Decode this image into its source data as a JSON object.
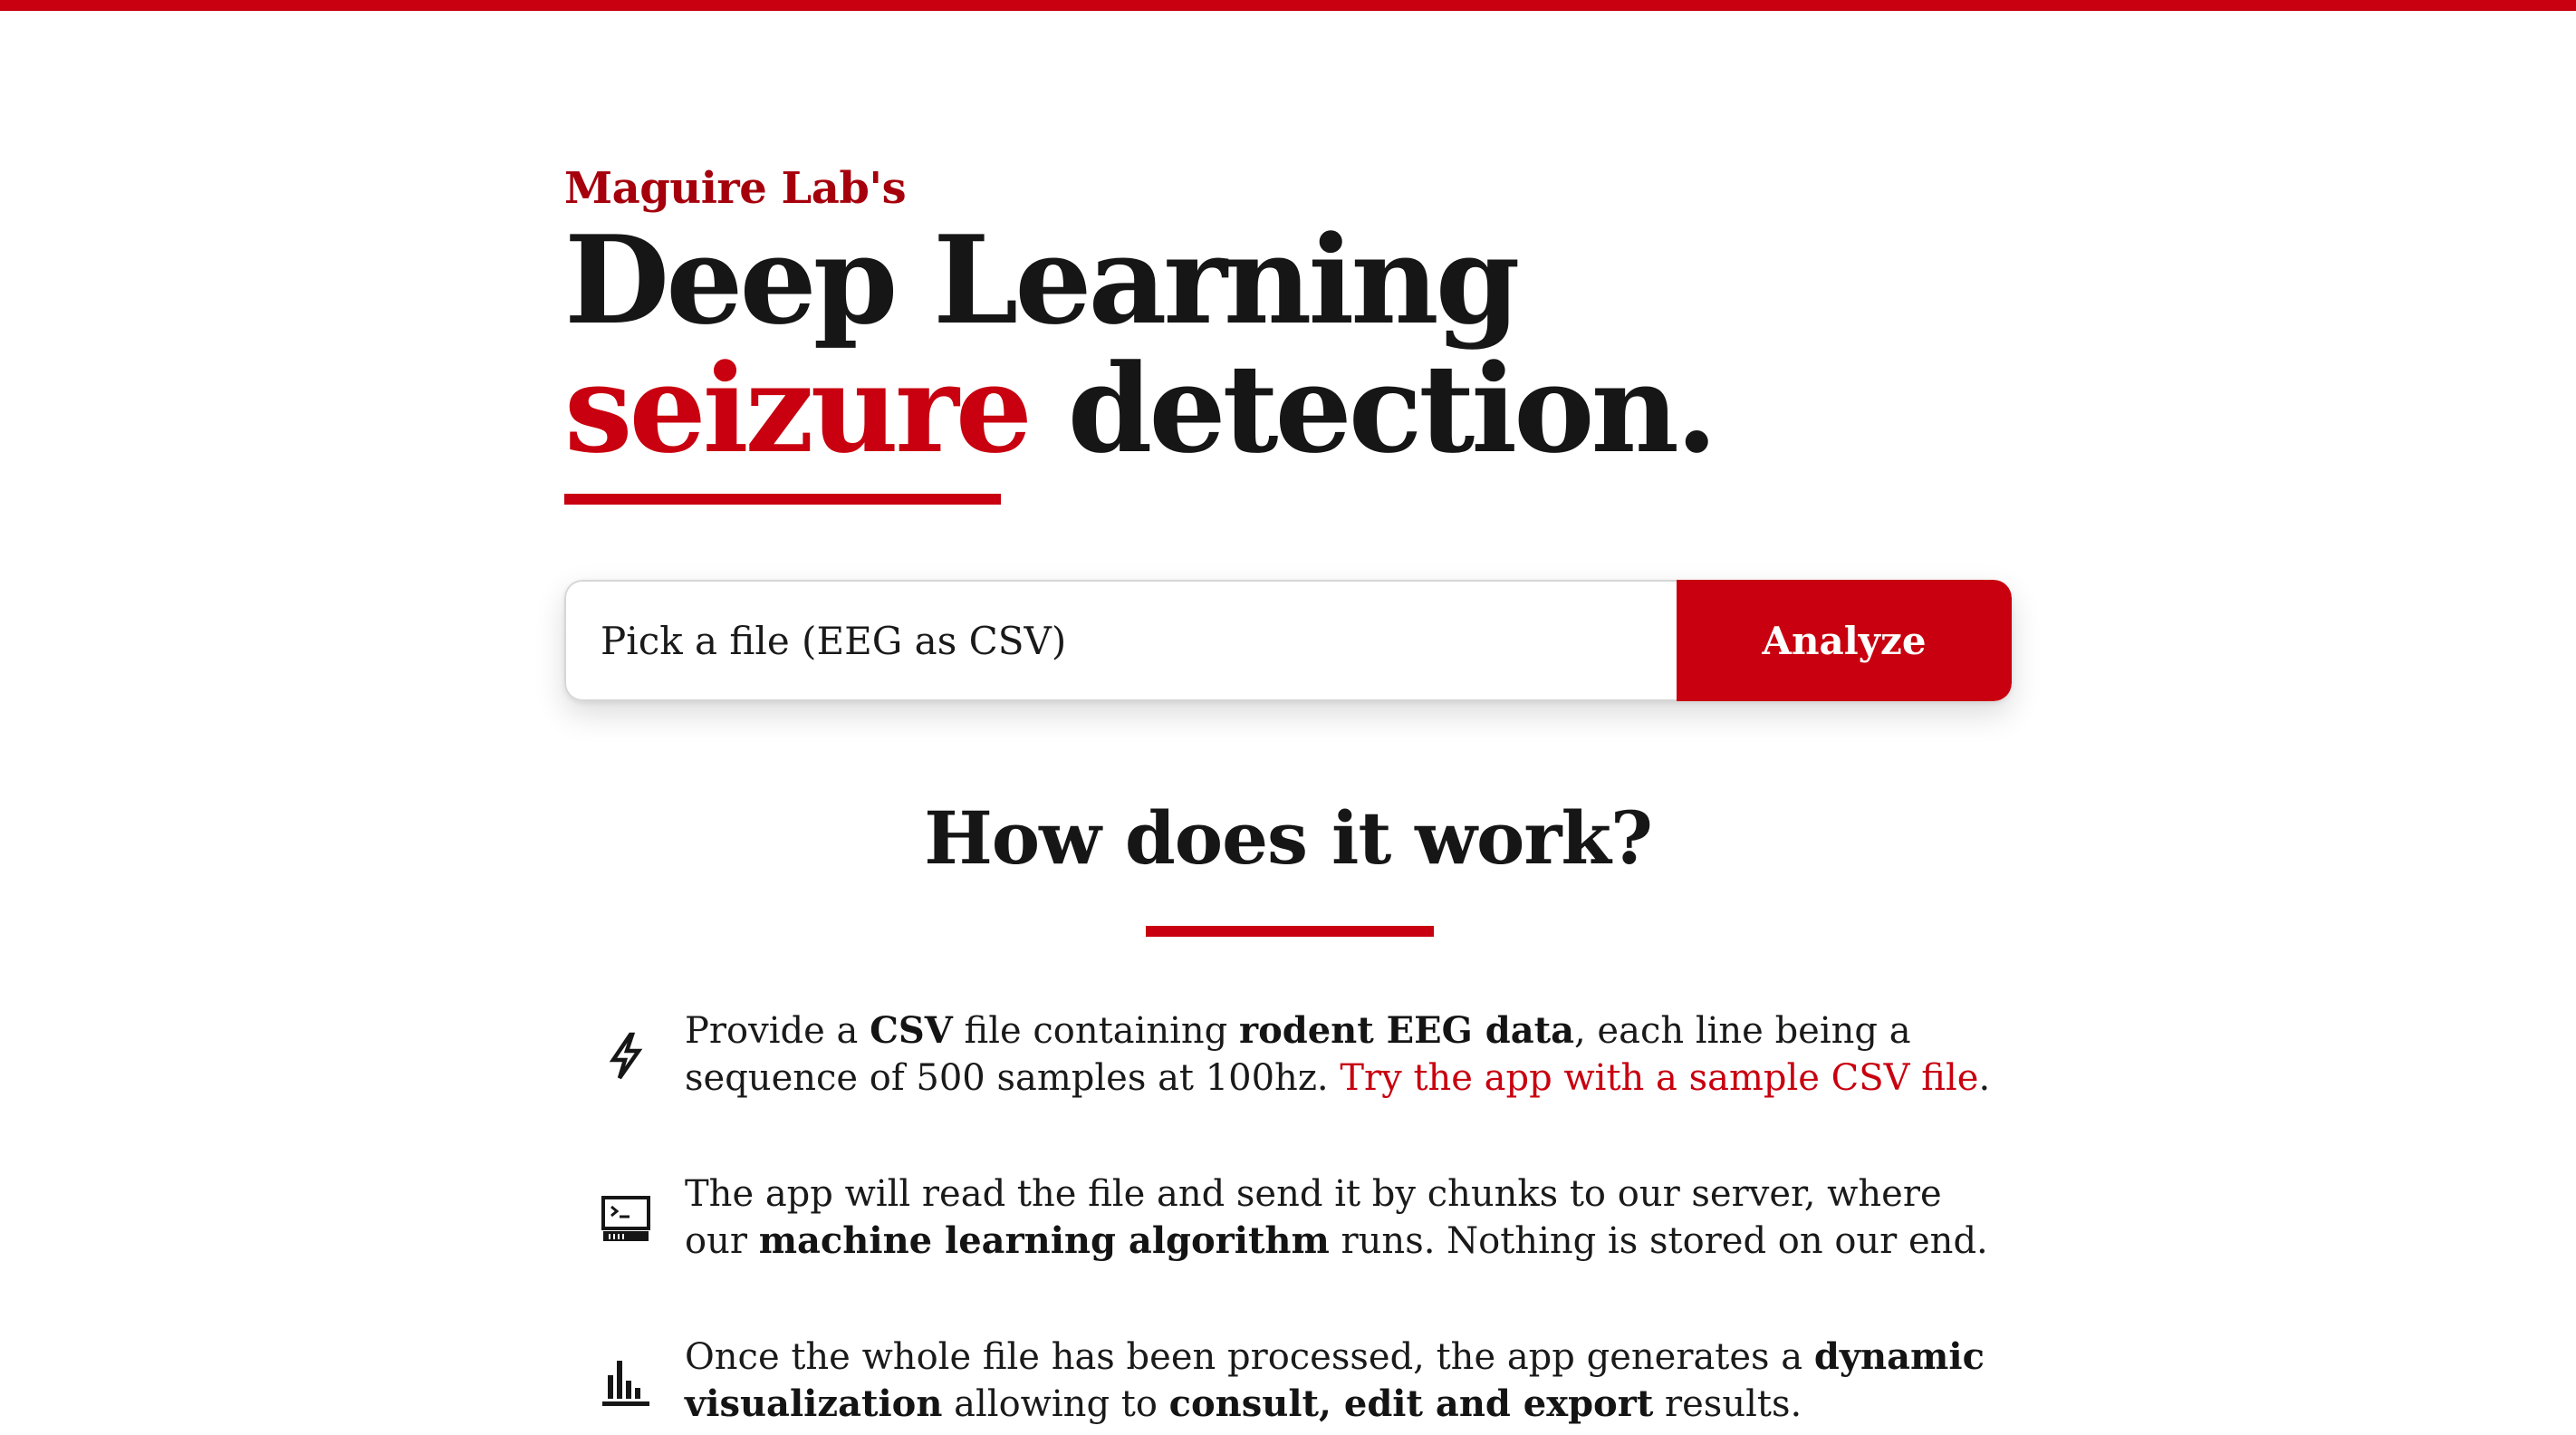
{
  "header": {
    "kicker": "Maguire Lab's",
    "headline_line1": "Deep Learning",
    "headline_accent": "seizure",
    "headline_rest": " detection."
  },
  "upload": {
    "file_placeholder": "Pick a file (EEG as CSV)",
    "analyze_label": "Analyze"
  },
  "how_it_works": {
    "title": "How does it work?",
    "steps": [
      {
        "icon": "lightning-bolt-icon",
        "t1": "Provide a ",
        "b1": "CSV",
        "t2": " file containing ",
        "b2": "rodent EEG data",
        "t3": ", each line being a sequence of 500 samples at 100hz. ",
        "link": "Try the app with a sample CSV file",
        "t4": "."
      },
      {
        "icon": "terminal-icon",
        "t1": "The app will read the file and send it by chunks to our server, where our ",
        "b1": "machine learning algorithm",
        "t2": " runs. Nothing is stored on our end."
      },
      {
        "icon": "bar-chart-icon",
        "t1": "Once the whole file has been processed, the app generates a ",
        "b1": "dynamic visualization",
        "t2": " allowing to ",
        "b2": "consult, edit and export",
        "t3": " results."
      }
    ]
  },
  "colors": {
    "accent": "#c8000f",
    "kicker": "#a5000c",
    "text": "#161616"
  }
}
